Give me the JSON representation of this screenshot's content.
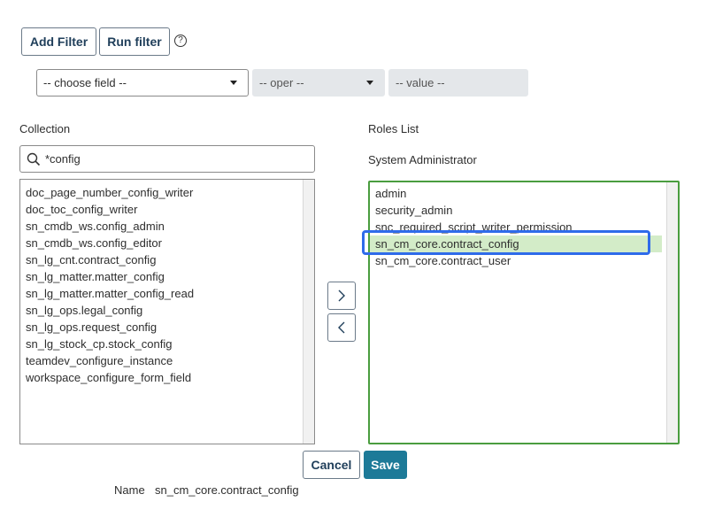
{
  "toolbar": {
    "add_filter_label": "Add Filter",
    "run_filter_label": "Run filter",
    "help_glyph": "?"
  },
  "filter": {
    "field_value": "-- choose field --",
    "oper_value": "-- oper --",
    "value_value": "-- value --"
  },
  "collection": {
    "heading": "Collection",
    "search_value": "*config",
    "items": [
      "doc_page_number_config_writer",
      "doc_toc_config_writer",
      "sn_cmdb_ws.config_admin",
      "sn_cmdb_ws.config_editor",
      "sn_lg_cnt.contract_config",
      "sn_lg_matter.matter_config",
      "sn_lg_matter.matter_config_read",
      "sn_lg_ops.legal_config",
      "sn_lg_ops.request_config",
      "sn_lg_stock_cp.stock_config",
      "teamdev_configure_instance",
      "workspace_configure_form_field"
    ]
  },
  "roles": {
    "heading": "Roles List",
    "subheading": "System Administrator",
    "items": [
      "admin",
      "security_admin",
      "snc_required_script_writer_permission",
      "sn_cm_core.contract_config",
      "sn_cm_core.contract_user"
    ],
    "selected_index": 3
  },
  "actions": {
    "add_glyph": "›",
    "remove_glyph": "‹",
    "cancel_label": "Cancel",
    "save_label": "Save"
  },
  "footer": {
    "name_label": "Name",
    "name_value": "sn_cm_core.contract_config"
  },
  "colors": {
    "accent": "#1d7a98",
    "selection": "#d3ecc8",
    "list_border_active": "#4a9d3f",
    "focus_ring": "#2f6bea"
  },
  "icons": [
    "help-icon",
    "search-icon",
    "chevron-down-icon",
    "chevron-right-icon",
    "chevron-left-icon"
  ]
}
